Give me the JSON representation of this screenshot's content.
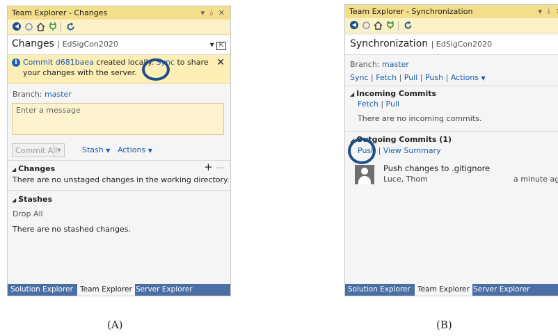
{
  "panelA": {
    "title": "Team Explorer - Changes",
    "title_controls": "▾ ⫰ ✕",
    "page_title": "Changes",
    "repo": "EdSigCon2020",
    "info": {
      "commit_link": "Commit d681baea",
      "text_mid": "created locally.",
      "sync_link": "Sync",
      "text_end": "to share your changes with the server."
    },
    "branch_label": "Branch:",
    "branch": "master",
    "message_placeholder": "Enter a message",
    "commit_all": "Commit All",
    "stash": "Stash",
    "actions": "Actions",
    "changes_header": "Changes",
    "changes_empty": "There are no unstaged changes in the working directory.",
    "stashes_header": "Stashes",
    "drop_all": "Drop All",
    "stashes_empty": "There are no stashed changes.",
    "tabs": [
      "Solution Explorer",
      "Team Explorer",
      "Server Explorer"
    ]
  },
  "panelB": {
    "title": "Team Explorer - Synchronization",
    "title_controls": "▾ ⫰ ✕",
    "page_title": "Synchronization",
    "repo": "EdSigCon2020",
    "branch_label": "Branch:",
    "branch": "master",
    "nav": [
      "Sync",
      "Fetch",
      "Pull",
      "Push",
      "Actions"
    ],
    "incoming_header": "Incoming Commits",
    "incoming_links": [
      "Fetch",
      "Pull"
    ],
    "incoming_empty": "There are no incoming commits.",
    "outgoing_header": "Outgoing Commits (1)",
    "push": "Push",
    "view_summary": "View Summary",
    "commit": {
      "message": "Push changes to .gitignore",
      "author": "Luce, Thom",
      "time": "a minute ago"
    },
    "tabs": [
      "Solution Explorer",
      "Team Explorer",
      "Server Explorer"
    ]
  },
  "captions": [
    "(A)",
    "(B)"
  ],
  "colors": {
    "title_bar": "#f4dd8b",
    "info_bar": "#fdeeb6",
    "tab_strip": "#4a6fa5",
    "link": "#1a5cb0",
    "annotation": "#1f4e8c"
  }
}
